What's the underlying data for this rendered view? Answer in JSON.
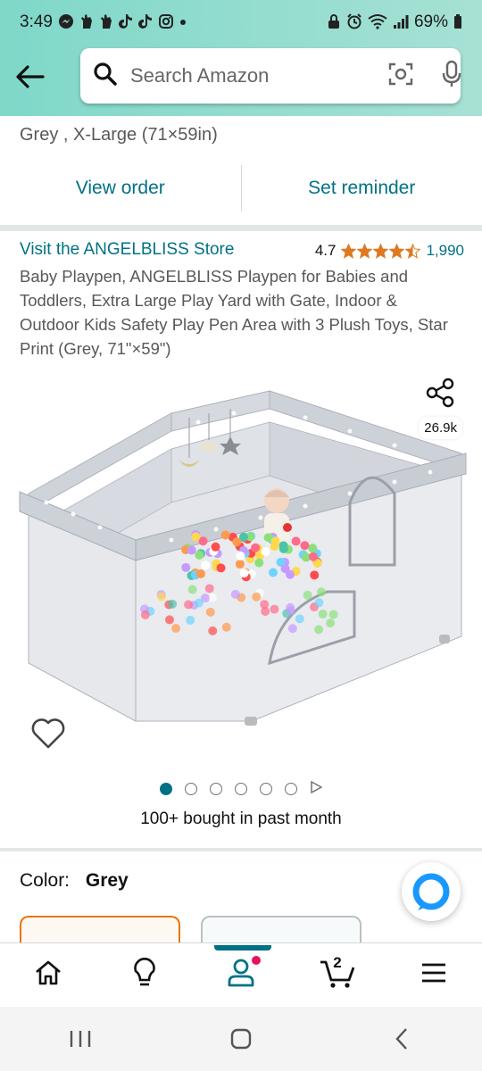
{
  "status_bar": {
    "time": "3:49",
    "battery": "69%",
    "left_icons": [
      "messenger-icon",
      "hand-icon",
      "hand-icon",
      "tiktok-icon",
      "tiktok-icon",
      "instagram-icon",
      "dot-icon"
    ],
    "right_icons": [
      "lock-icon",
      "alarm-icon",
      "wifi-icon",
      "signal-icon",
      "battery-icon"
    ]
  },
  "header": {
    "search_placeholder": "Search Amazon",
    "bg_color": "#86dccd"
  },
  "order": {
    "detail": "Grey , X-Large (71×59in)",
    "view_order_label": "View order",
    "set_reminder_label": "Set reminder"
  },
  "product": {
    "store_link": "Visit the ANGELBLISS Store",
    "rating_value": "4.7",
    "rating_stars": 4.5,
    "rating_count": "1,990",
    "title": "Baby Playpen, ANGELBLISS Playpen for Babies and Toddlers, Extra Large Play Yard with Gate, Indoor & Outdoor Kids Safety Play Pen Area with 3 Plush Toys, Star Print (Grey, 71\"×59\")",
    "share_count": "26.9k",
    "image_count": 6,
    "active_image": 0,
    "bought_text": "100+ bought in past month"
  },
  "color": {
    "label": "Color:",
    "value": "Grey"
  },
  "bottom_nav": {
    "items": [
      "home-icon",
      "lightbulb-icon",
      "account-icon",
      "cart-icon",
      "menu-icon"
    ],
    "active": "account-icon",
    "cart_count": "2"
  },
  "colors": {
    "link": "#007185",
    "star": "#de7921",
    "selected_border": "#e77600",
    "notification": "#e3145c",
    "rufus": "#1a98ff"
  }
}
